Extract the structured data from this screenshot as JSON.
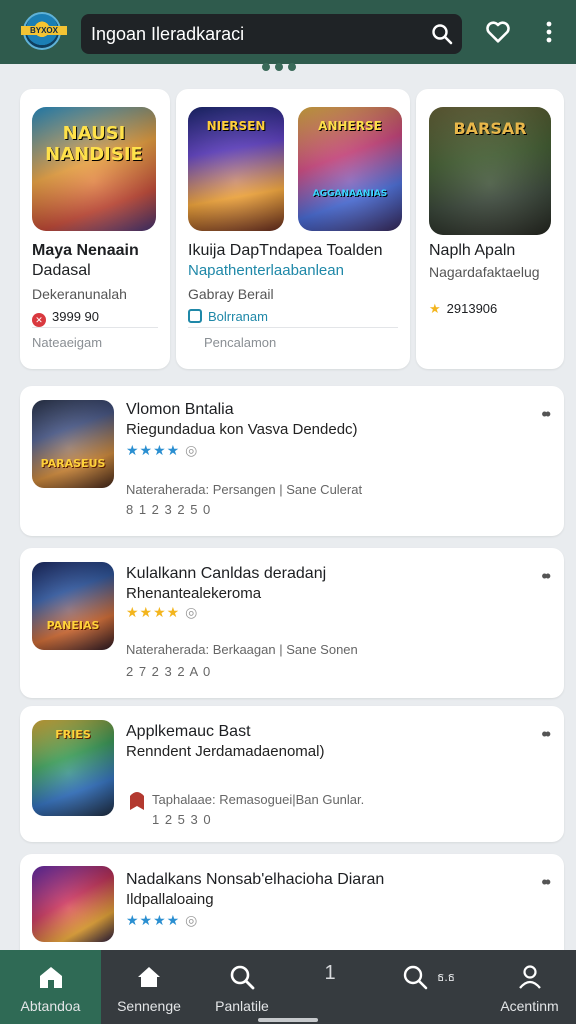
{
  "header": {
    "logo_text": "BYXOX",
    "search_value": "Ingoan Ileradkaraci"
  },
  "featured": [
    {
      "art_text": "NAUSI NANDISIE",
      "title": "Maya Nenaain",
      "title2": "Dadasal",
      "subtitle": "Dekeranunalah",
      "rating_text": "3999 90",
      "rating_badge": "red-circle-icon",
      "footer": "Nateaeigam"
    },
    {
      "art_text": "NIERSEN",
      "art_text2": "ANHERSE",
      "art_text3": "AGGANAANIAS",
      "title": "Ikuija DapTndapea Toalden",
      "title2": "Napathenterlaabanlean",
      "subtitle": "Gabray Berail",
      "rating_text": "Bolrranam",
      "rating_badge": "bag-icon",
      "footer": "Pencalamon"
    },
    {
      "art_text": "BARSAR",
      "title": "Naplh Apaln",
      "title2": "Nagardafaktaelug",
      "subtitle": "",
      "rating_text": "2913906",
      "rating_badge": "star-icon",
      "footer": ""
    }
  ],
  "list": [
    {
      "thumb_text": "PARASEUS",
      "title": "Vlomon Bntalia",
      "subtitle": "Riegundadua kon Vasva Dendedc)",
      "stars": "★★★★",
      "star_color": "#2b8fd1",
      "meta": "Nateraherada: Persangen | Sane Culerat",
      "code": "8 1 2 3 2 5 0"
    },
    {
      "thumb_text": "PANEIAS",
      "title": "Kulalkann Canldas deradanj",
      "subtitle": "Rhenantealekeroma",
      "stars": "★★★★",
      "star_color": "#f3b51e",
      "meta": "Nateraherada: Berkaagan | Sane Sonen",
      "code": "2 7 2 3 2 A 0"
    },
    {
      "thumb_text": "FRIES",
      "title": "Applkemauc Bast",
      "subtitle": "Renndent Jerdamadaenomal)",
      "stars": "",
      "star_color": "#c0392b",
      "meta": "Taphalaae: Remasoguei|Ban Gunlar.",
      "code": "1 2 5 3 0"
    },
    {
      "thumb_text": "",
      "title": "Nadalkans Nonsab'elhacioha Diaran",
      "subtitle": "Ildpallaloaing",
      "stars": "★★★★",
      "star_color": "#2b8fd1",
      "meta": "",
      "code": ""
    }
  ],
  "nav": [
    {
      "label": "Abtandoa",
      "icon": "home-icon"
    },
    {
      "label": "Sennenge",
      "icon": "house-icon"
    },
    {
      "label": "Panlatile",
      "icon": "search-icon"
    },
    {
      "label": "",
      "number": "1"
    },
    {
      "label": "",
      "icon": "search-icon",
      "suffix": "ธ.ธ"
    },
    {
      "label": "Acentinm",
      "icon": "person-icon"
    }
  ],
  "colors": {
    "header": "#2f5b4d",
    "nav_bg": "#363b3f",
    "nav_active": "#2f6a55",
    "accent_blue": "#1f88a8"
  }
}
